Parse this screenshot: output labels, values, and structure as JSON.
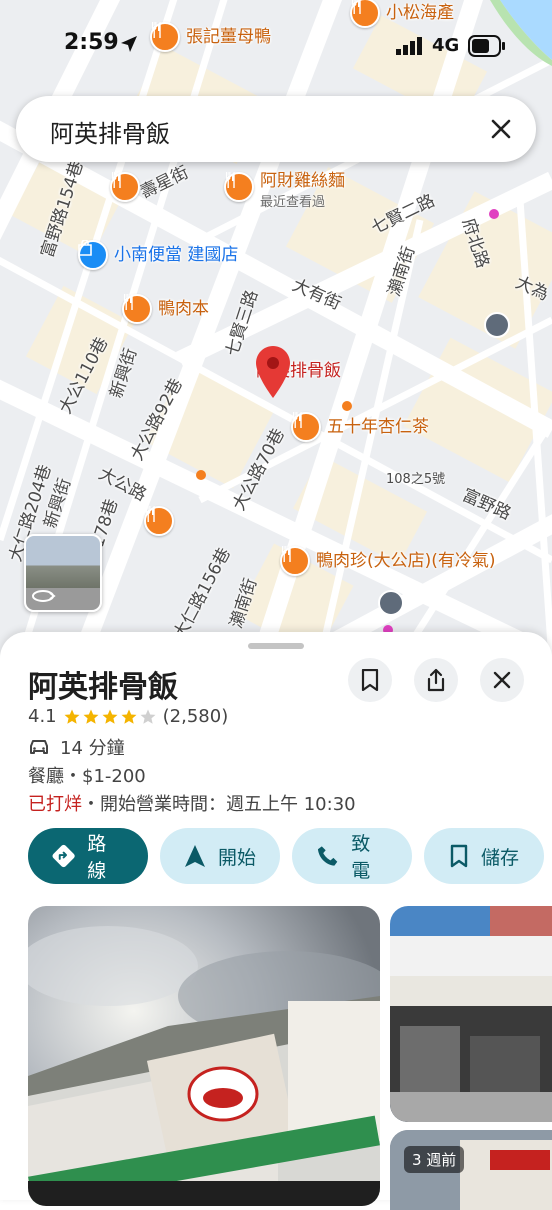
{
  "status_bar": {
    "time": "2:59",
    "network": "4G"
  },
  "search": {
    "query": "阿英排骨飯"
  },
  "map": {
    "selected_place": "阿英排骨飯",
    "pois": [
      {
        "id": "zhangji",
        "label": "張記薑母鴨"
      },
      {
        "id": "xiaosong",
        "label": "小松海產"
      },
      {
        "id": "acai",
        "label": "阿財雞絲麵",
        "sub": "最近查看過"
      },
      {
        "id": "xiaonan",
        "label": "小南便當 建國店"
      },
      {
        "id": "yaroben",
        "label": "鴨肉本"
      },
      {
        "id": "wushinian",
        "label": "五十年杏仁茶"
      },
      {
        "id": "yarouzhen",
        "label": "鴨肉珍(大公店)(有冷氣)"
      }
    ],
    "streets": {
      "qixian2": "七賢二路",
      "qixian3": "七賢三路",
      "fubei": "府北路",
      "dayou": "大有街",
      "lainan1": "瀨南街",
      "lainan2": "瀨南街",
      "dawei": "大為",
      "fuye": "富野路",
      "fuye154": "富野路154巷",
      "xingxing": "壽星街",
      "dagong": "大公路",
      "dagong110": "大公110巷",
      "dagong92": "大公路92巷",
      "dagong70": "大公路70巷",
      "xinxing1": "新興街",
      "xinxing2": "新興街",
      "daren204": "大仁路204巷",
      "daren178": "178巷",
      "daren156": "大仁路156巷",
      "address": "108之5號"
    }
  },
  "place": {
    "name": "阿英排骨飯",
    "rating": "4.1",
    "stars": 4,
    "reviews": "(2,580)",
    "drive_time": "14 分鐘",
    "category": "餐廳・$1-200",
    "status": "已打烊",
    "hours": "・開始營業時間：週五上午 10:30"
  },
  "actions": {
    "directions": "路線",
    "start": "開始",
    "call": "致電",
    "save": "儲存"
  },
  "photos": {
    "badge": "3 週前"
  },
  "icons": {
    "restaurant": "fork-knife-icon",
    "shop": "shopping-bag-icon",
    "bus": "bus-icon",
    "bookmark": "bookmark-icon",
    "share": "share-icon",
    "close": "close-icon",
    "car": "car-icon",
    "directions": "directions-icon",
    "navigate": "navigation-arrow-icon",
    "phone": "phone-icon"
  },
  "colors": {
    "accent": "#0b6772",
    "accent_light": "#d2ecf5",
    "poi": "#f47f1f",
    "pin": "#e53935",
    "closed": "#c5221f",
    "star": "#f4b400"
  }
}
